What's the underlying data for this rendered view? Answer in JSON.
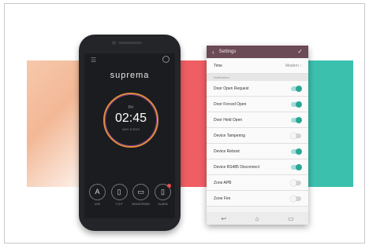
{
  "phone": {
    "brand": "suprema",
    "clock": {
      "day": "Fri",
      "time": "02:45",
      "date": "MAY 8 2015"
    },
    "buttons": [
      {
        "label": "USE",
        "icon": "user-icon",
        "glyph": "A"
      },
      {
        "label": "T.O.P",
        "icon": "door-icon",
        "glyph": "▯"
      },
      {
        "label": "MONITORING",
        "icon": "monitor-icon",
        "glyph": "▭"
      },
      {
        "label": "ALARM",
        "icon": "alarm-icon",
        "glyph": "▯"
      }
    ]
  },
  "settings": {
    "title": "Settings",
    "time_row": {
      "label": "Time",
      "value": "Modern"
    },
    "section": "Notification",
    "toggles": [
      {
        "label": "Door Open Request",
        "on": true
      },
      {
        "label": "Door Forced Open",
        "on": true
      },
      {
        "label": "Door Held Open",
        "on": true
      },
      {
        "label": "Device Tampering",
        "on": false
      },
      {
        "label": "Device Reboot",
        "on": true
      },
      {
        "label": "Device RS485 Disconnect",
        "on": true
      },
      {
        "label": "Zone APB",
        "on": false
      },
      {
        "label": "Zone Fire",
        "on": false
      }
    ],
    "navbar": [
      "↩",
      "⌂",
      "▭"
    ]
  },
  "colors": {
    "orange": "#f2b08d",
    "red": "#ef5e63",
    "teal": "#3cc0ae",
    "header": "#6b4b55",
    "toggle_on": "#2aa897"
  }
}
